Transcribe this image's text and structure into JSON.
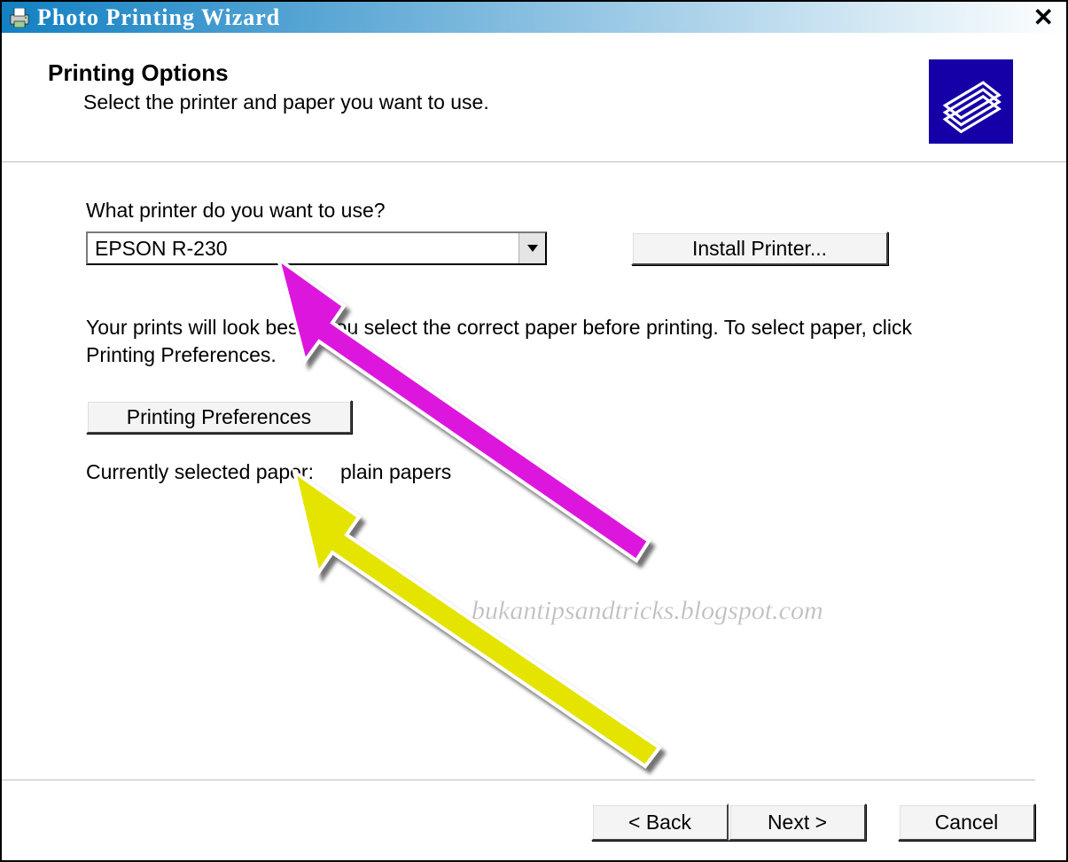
{
  "window": {
    "title": "Photo Printing Wizard"
  },
  "header": {
    "title": "Printing Options",
    "subtitle": "Select the printer and paper you want to use."
  },
  "printer": {
    "label": "What printer do you want to use?",
    "selected": "EPSON  R-230",
    "install_button": "Install Printer..."
  },
  "instruction": "Your prints will look best if you select the correct paper before printing. To select paper, click Printing Preferences.",
  "prefs_button": "Printing Preferences",
  "paper": {
    "label": "Currently selected paper:",
    "value": "plain papers"
  },
  "footer": {
    "back": "< Back",
    "next": "Next >",
    "cancel": "Cancel"
  },
  "watermark": "bukantipsandtricks.blogspot.com"
}
